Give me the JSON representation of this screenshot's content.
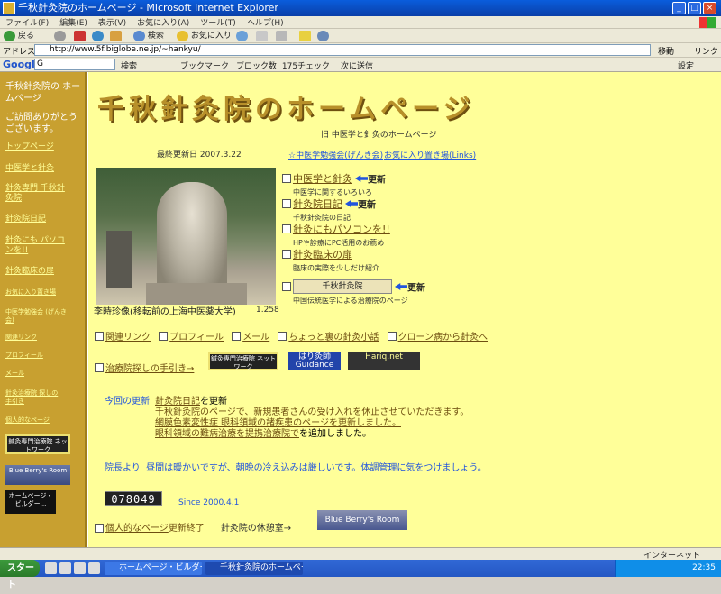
{
  "window": {
    "title": "千秋針灸院のホームページ - Microsoft Internet Explorer"
  },
  "menubar": [
    "ファイル(F)",
    "編集(E)",
    "表示(V)",
    "お気に入り(A)",
    "ツール(T)",
    "ヘルプ(H)"
  ],
  "toolbar": {
    "back": "戻る",
    "search": "検索",
    "favorites": "お気に入り"
  },
  "address": {
    "label": "アドレス(D)",
    "url": "http://www.5f.biglobe.ne.jp/~hankyu/",
    "go": "移動",
    "links": "リンク"
  },
  "google_bar": {
    "logo": "Google",
    "field": "G",
    "search": "検索",
    "bookmarks": "ブックマーク",
    "blocked": "ブロック数: 175",
    "check": "チェック",
    "next": "次に送信",
    "settings": "設定"
  },
  "left_nav": {
    "site_title": "千秋針灸院の ホームページ",
    "greeting": "ご訪問ありがとう ございます。",
    "items": [
      "トップページ",
      "中医学と針灸",
      "針灸専門 千秋針灸院",
      "針灸院日記",
      "針灸にも パソコンを!!",
      "針灸臨床の扉",
      "お気に入り置き場",
      "中医学勉強会 (げんき会)",
      "関連リンク",
      "プロフィール",
      "メール",
      "針灸治療院 探しの手引き",
      "個人的なページ"
    ],
    "banners": [
      "鍼灸専門治療院 ネットワーク",
      "Blue Berry's Room",
      "ホームページ・ ビルダー..."
    ]
  },
  "main": {
    "logo_text": "千秋針灸院のホームページ",
    "subtitle": "旧 中医学と針灸のホームページ",
    "last_updated": "最終更新日 2007.3.22",
    "association": "☆中医学勉強会(げんき会)",
    "favorites_link": "お気に入り置き場(Links)",
    "photo_caption": "李時珍像(移転前の上海中医薬大学)",
    "photo_number": "1.258",
    "sections": [
      {
        "title": "中医学と針灸",
        "badge": "更新",
        "desc": "中医学に関するいろいろ"
      },
      {
        "title": "針灸院日記",
        "badge": "更新",
        "desc": "千秋針灸院の日記"
      },
      {
        "title": "針灸にもパソコンを!!",
        "badge": "",
        "desc": "HPや診療にPC活用のお薦め"
      },
      {
        "title": "針灸臨床の扉",
        "badge": "",
        "desc": "臨床の実際を少しだけ紹介"
      },
      {
        "title": "千秋針灸院",
        "badge": "更新",
        "desc": "中国伝統医学による治療院のページ"
      }
    ],
    "nav_row": [
      "関連リンク",
      "プロフィール",
      "メール",
      "ちょっと裏の針灸小話",
      "クローン病から針灸へ"
    ],
    "search_guide": "治療院探しの手引き→",
    "banners": [
      "鍼灸専門治療院 ネットワーク",
      "はり灸師 Guidance",
      "Hariq.net"
    ],
    "news": {
      "label": "今回の更新",
      "line1_link": "針灸院日記",
      "line1_tail": "を更新",
      "line2": "千秋針灸院のページで、新規患者さんの受け入れを休止させていただきます。",
      "line3": "網膜色素変性症 眼科領域の諸疾患のページを更新しました。",
      "line4_link": "眼科領域の難病治療を提携治療院で",
      "line4_tail": "を追加しました。"
    },
    "director": {
      "label": "院長より",
      "message": "昼間は暖かいですが、朝晩の冷え込みは厳しいです。体調管理に気をつけましょう。"
    },
    "counter": "078049",
    "since": "Since 2000.4.1",
    "footer": {
      "link": "個人的なページ",
      "tail": "更新終了",
      "text": "針灸院の休憩室→"
    },
    "rest_banner": "Blue Berry's Room"
  },
  "statusbar": {
    "zone": "インターネット"
  },
  "taskbar": {
    "start": "スタート",
    "tasks": [
      "ホームページ・ビルダー - [...",
      "千秋針灸院のホームページ..."
    ],
    "clock": "22:35"
  }
}
